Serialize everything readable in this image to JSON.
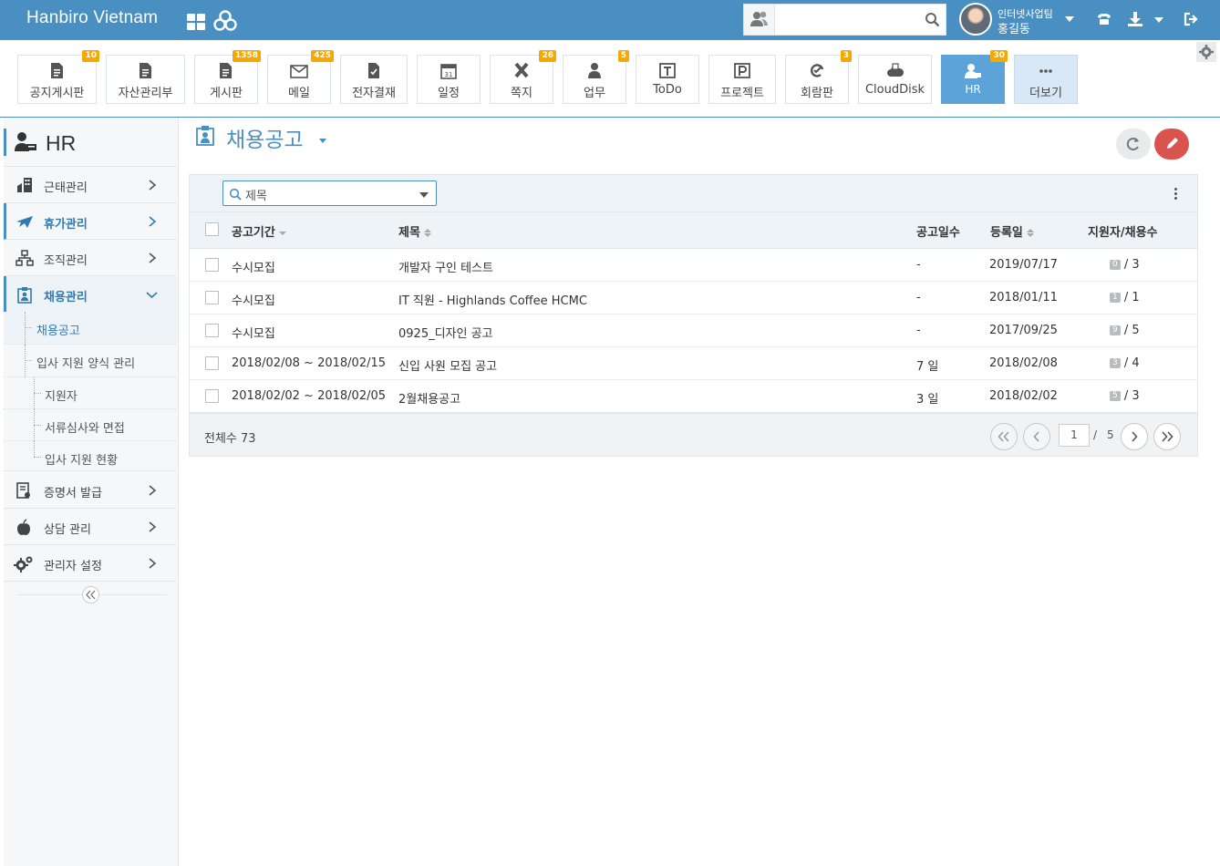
{
  "header": {
    "brand": "Hanbiro Vietnam",
    "search_placeholder": "",
    "user_team": "인터넷사업팀",
    "user_name": "홍길동"
  },
  "apps": [
    {
      "label": "공지게시판",
      "badge": "10",
      "icon": "board-icon"
    },
    {
      "label": "자산관리부",
      "badge": "",
      "icon": "board-icon"
    },
    {
      "label": "게시판",
      "badge": "1358",
      "icon": "board-icon"
    },
    {
      "label": "메일",
      "badge": "425",
      "icon": "mail-icon"
    },
    {
      "label": "전자결재",
      "badge": "",
      "icon": "approval-icon"
    },
    {
      "label": "일정",
      "badge": "",
      "icon": "calendar-icon"
    },
    {
      "label": "쪽지",
      "badge": "26",
      "icon": "memo-icon"
    },
    {
      "label": "업무",
      "badge": "5",
      "icon": "task-icon"
    },
    {
      "label": "ToDo",
      "badge": "",
      "icon": "todo-icon"
    },
    {
      "label": "프로젝트",
      "badge": "",
      "icon": "project-icon"
    },
    {
      "label": "회람판",
      "badge": "3",
      "icon": "circular-icon"
    },
    {
      "label": "CloudDisk",
      "badge": "",
      "icon": "cloud-icon"
    },
    {
      "label": "HR",
      "badge": "30",
      "icon": "hr-icon"
    },
    {
      "label": "더보기",
      "badge": "",
      "icon": "more-icon"
    }
  ],
  "sidebar": {
    "title": "HR",
    "menu": [
      {
        "label": "근태관리"
      },
      {
        "label": "휴가관리"
      },
      {
        "label": "조직관리"
      },
      {
        "label": "채용관리"
      }
    ],
    "submenu": [
      {
        "label": "채용공고"
      },
      {
        "label": "입사 지원 양식 관리"
      },
      {
        "label": "지원자"
      },
      {
        "label": "서류심사와 면접"
      },
      {
        "label": "입사 지원 현황"
      }
    ],
    "menu2": [
      {
        "label": "증명서 발급"
      },
      {
        "label": "상담 관리"
      },
      {
        "label": "관리자 설정"
      }
    ]
  },
  "main": {
    "title": "채용공고",
    "filter": {
      "selected": "제목"
    },
    "columns": {
      "period": "공고기간",
      "title": "제목",
      "days": "공고일수",
      "date": "등록일",
      "applicants": "지원자/채용수"
    },
    "rows": [
      {
        "period": "수시모집",
        "title": "개발자 구인 테스트",
        "days": "-",
        "date": "2019/07/17",
        "applicants": "0",
        "hires": "/ 3"
      },
      {
        "period": "수시모집",
        "title": "IT 직원 - Highlands Coffee HCMC",
        "days": "-",
        "date": "2018/01/11",
        "applicants": "1",
        "hires": "/ 1"
      },
      {
        "period": "수시모집",
        "title": "0925_디자인 공고",
        "days": "-",
        "date": "2017/09/25",
        "applicants": "9",
        "hires": "/ 5"
      },
      {
        "period": "2018/02/08 ~ 2018/02/15",
        "title": "신입 사원 모집 공고",
        "days": "7 일",
        "date": "2018/02/08",
        "applicants": "3",
        "hires": "/ 4"
      },
      {
        "period": "2018/02/02 ~ 2018/02/05",
        "title": "2월채용공고",
        "days": "3 일",
        "date": "2018/02/02",
        "applicants": "5",
        "hires": "/ 3"
      }
    ],
    "footer": {
      "total": "전체수 73",
      "page": "1",
      "sep": "/",
      "pages": "5"
    }
  },
  "colors": {
    "header": "#4a8fc1",
    "accent": "#2f7bb6",
    "badge": "#f5a800",
    "write_button": "#d9534f"
  }
}
